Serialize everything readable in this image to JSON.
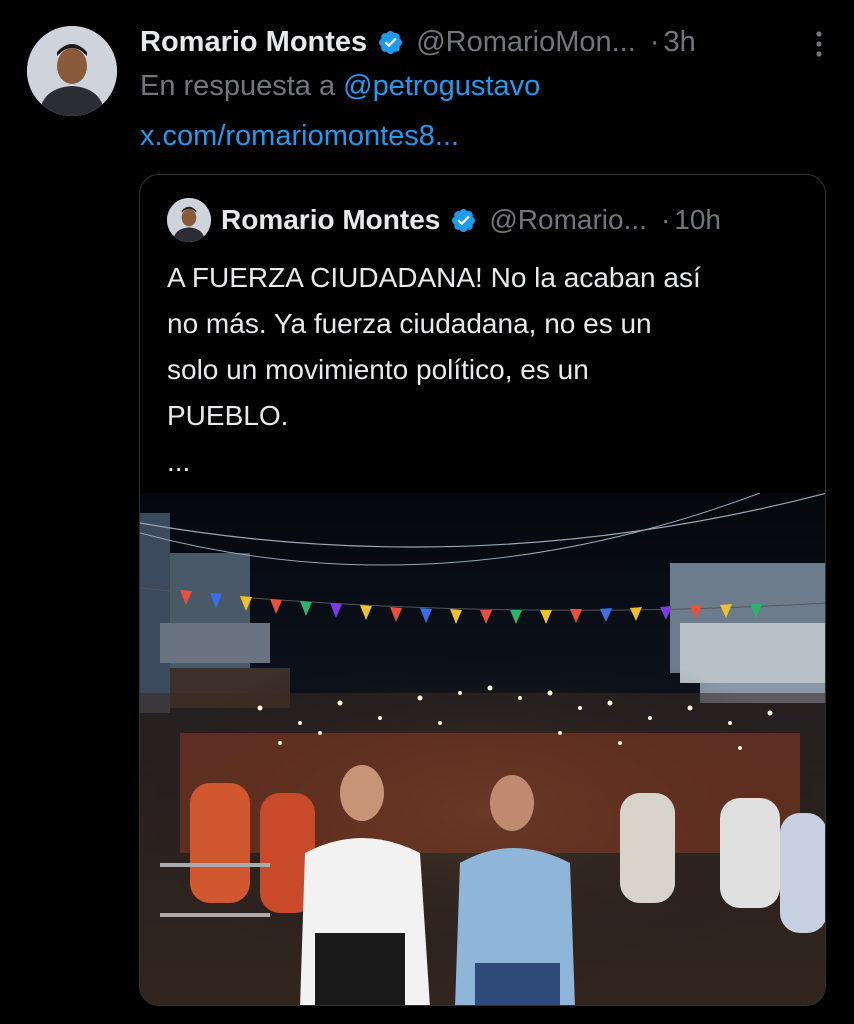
{
  "tweet": {
    "author_name": "Romario Montes",
    "handle": "@RomarioMon...",
    "dot": "·",
    "time": "3h",
    "reply_prefix": "En respuesta a",
    "reply_mention": "@petrogustavo",
    "link_text": "x.com/romariomontes8..."
  },
  "quote": {
    "author_name": "Romario Montes",
    "handle": "@Romario...",
    "dot": "·",
    "time": "10h",
    "text_lines": [
      "A FUERZA CIUDADANA! No la acaban así",
      "no más. Ya fuerza ciudadana, no es un",
      "solo un movimiento político, es un",
      "PUEBLO.",
      "..."
    ],
    "image_alt": "Photo: crowd rally at night with phone lights, two men in front"
  },
  "colors": {
    "background": "#000000",
    "text": "#e7e9ea",
    "secondary": "#71767b",
    "link": "#1d9bf0",
    "border": "#2f3336"
  },
  "icons": [
    "verified-badge-icon",
    "more-options-icon"
  ]
}
